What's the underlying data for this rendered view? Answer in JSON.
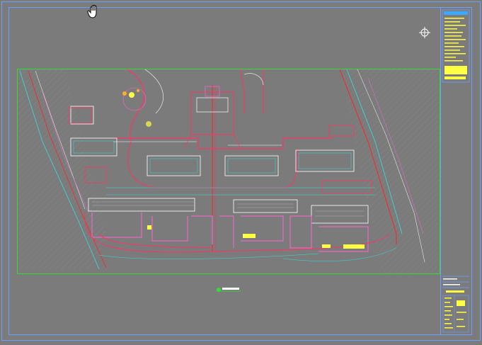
{
  "app": {
    "viewport_background": "#7b7b7b",
    "sheet_border_color": "#6aa0ff",
    "drawing_frame_color": "#33dd33"
  },
  "cursor": {
    "icon": "pan-hand-icon"
  },
  "viewcube": {
    "icon": "crosshair-target-icon"
  },
  "plan": {
    "title_block_caption": "",
    "colors": {
      "road": "#ff3366",
      "building": "#ffffff",
      "boundary": "#ff2222",
      "cyan": "#33e0e0",
      "yellow": "#ffff44",
      "green": "#33dd33",
      "magenta": "#ff66cc"
    }
  }
}
